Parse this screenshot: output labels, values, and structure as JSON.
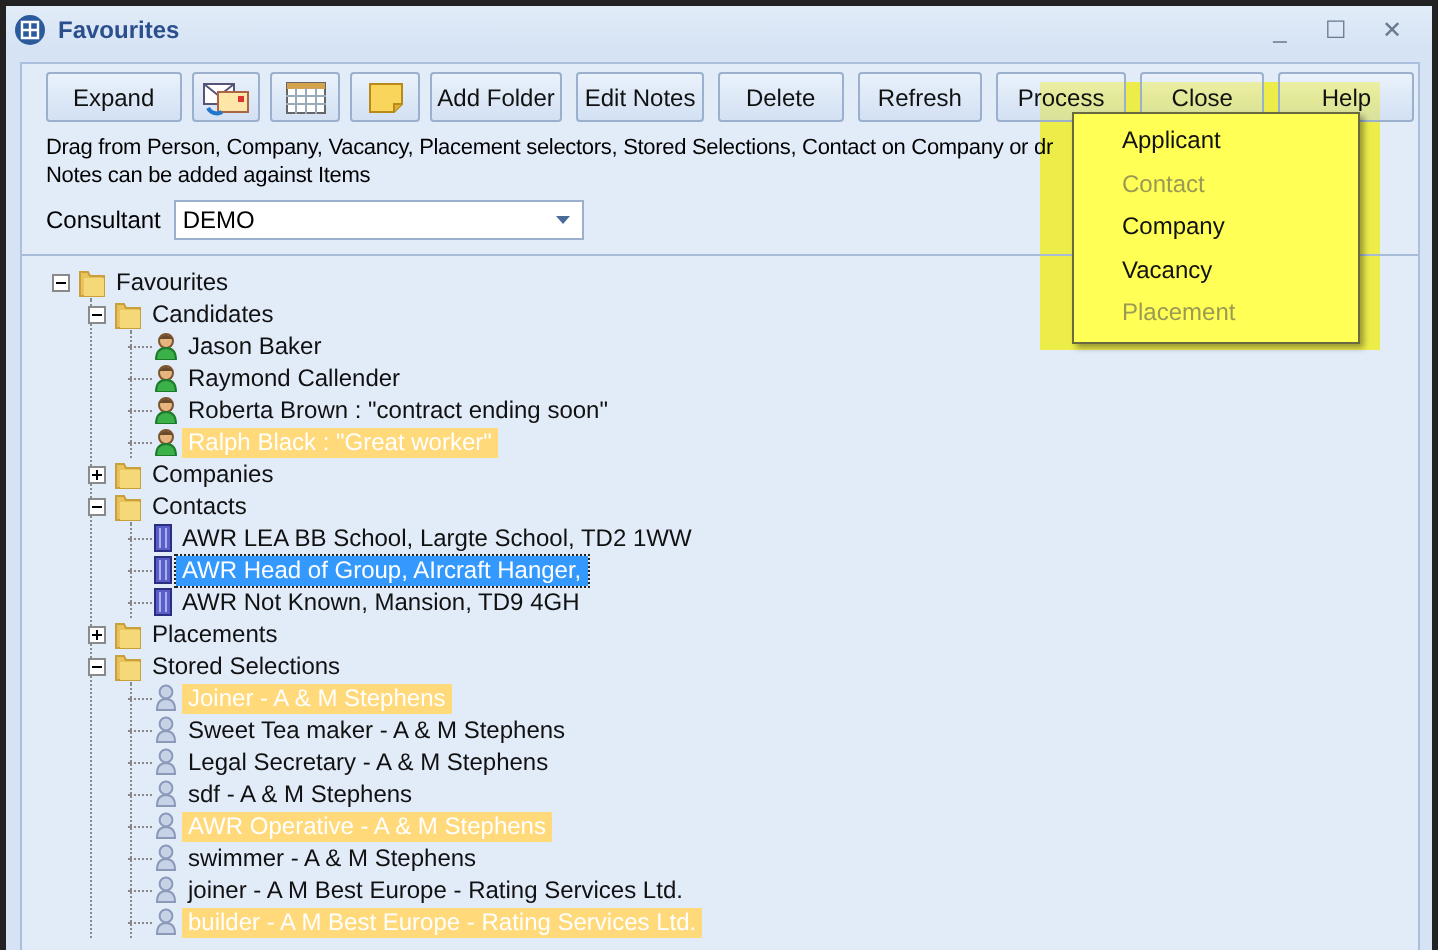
{
  "window": {
    "title": "Favourites",
    "controls": [
      "_",
      "☐",
      "✕"
    ]
  },
  "toolbar": [
    {
      "kind": "text",
      "label": "Expand"
    },
    {
      "kind": "icon"
    },
    {
      "kind": "icon"
    },
    {
      "kind": "icon"
    },
    {
      "kind": "text",
      "label": "Add Folder"
    },
    {
      "kind": "text",
      "label": "Edit Notes"
    },
    {
      "kind": "text",
      "label": "Delete"
    },
    {
      "kind": "text",
      "label": "Refresh"
    },
    {
      "kind": "text",
      "label": "Process"
    },
    {
      "kind": "text",
      "label": "Close"
    },
    {
      "kind": "text",
      "label": "Help"
    }
  ],
  "instructions": [
    "Drag from Person, Company, Vacancy, Placement selectors, Stored Selections, Contact on Company or dr",
    "Notes can be added against Items"
  ],
  "consultant": {
    "label": "Consultant",
    "value": "DEMO"
  },
  "tree": [
    {
      "kind": "folder",
      "label": "Favourites",
      "expanded": true,
      "selected": false,
      "flagged": false,
      "children": [
        {
          "kind": "folder",
          "label": "Candidates",
          "expanded": true,
          "selected": false,
          "flagged": false,
          "children": [
            {
              "kind": "person",
              "label": "Jason Baker",
              "selected": false,
              "flagged": false
            },
            {
              "kind": "person",
              "label": "Raymond Callender",
              "selected": false,
              "flagged": false
            },
            {
              "kind": "person",
              "label": "Roberta Brown : \"contract ending soon\"",
              "selected": false,
              "flagged": false
            },
            {
              "kind": "person",
              "label": "Ralph Black : \"Great worker\"",
              "selected": false,
              "flagged": true
            }
          ]
        },
        {
          "kind": "folder",
          "label": "Companies",
          "expanded": false,
          "selected": false,
          "flagged": false
        },
        {
          "kind": "folder",
          "label": "Contacts",
          "expanded": true,
          "selected": false,
          "flagged": false,
          "children": [
            {
              "kind": "contact",
              "label": "AWR LEA BB School, Largte School, TD2 1WW",
              "selected": false,
              "flagged": false
            },
            {
              "kind": "contact",
              "label": "AWR Head of Group, AIrcraft Hanger,",
              "selected": true,
              "flagged": false
            },
            {
              "kind": "contact",
              "label": "AWR Not Known, Mansion, TD9 4GH",
              "selected": false,
              "flagged": false
            }
          ]
        },
        {
          "kind": "folder",
          "label": "Placements",
          "expanded": false,
          "selected": false,
          "flagged": false
        },
        {
          "kind": "folder",
          "label": "Stored Selections",
          "expanded": true,
          "selected": false,
          "flagged": false,
          "children": [
            {
              "kind": "selection",
              "label": "Joiner - A & M Stephens",
              "selected": false,
              "flagged": true
            },
            {
              "kind": "selection",
              "label": "Sweet Tea maker - A & M Stephens",
              "selected": false,
              "flagged": false
            },
            {
              "kind": "selection",
              "label": "Legal Secretary - A & M Stephens",
              "selected": false,
              "flagged": false
            },
            {
              "kind": "selection",
              "label": "sdf - A & M Stephens",
              "selected": false,
              "flagged": false
            },
            {
              "kind": "selection",
              "label": "AWR Operative - A & M Stephens",
              "selected": false,
              "flagged": true
            },
            {
              "kind": "selection",
              "label": "swimmer - A & M Stephens",
              "selected": false,
              "flagged": false
            },
            {
              "kind": "selection",
              "label": "joiner - A M  Best Europe - Rating Services Ltd.",
              "selected": false,
              "flagged": false
            },
            {
              "kind": "selection",
              "label": "builder - A M  Best Europe - Rating Services Ltd.",
              "selected": false,
              "flagged": true
            }
          ]
        }
      ]
    }
  ],
  "process_menu": [
    {
      "label": "Applicant",
      "disabled": false
    },
    {
      "label": "Contact",
      "disabled": true
    },
    {
      "label": "Company",
      "disabled": false
    },
    {
      "label": "Vacancy",
      "disabled": false
    },
    {
      "label": "Placement",
      "disabled": true
    }
  ]
}
